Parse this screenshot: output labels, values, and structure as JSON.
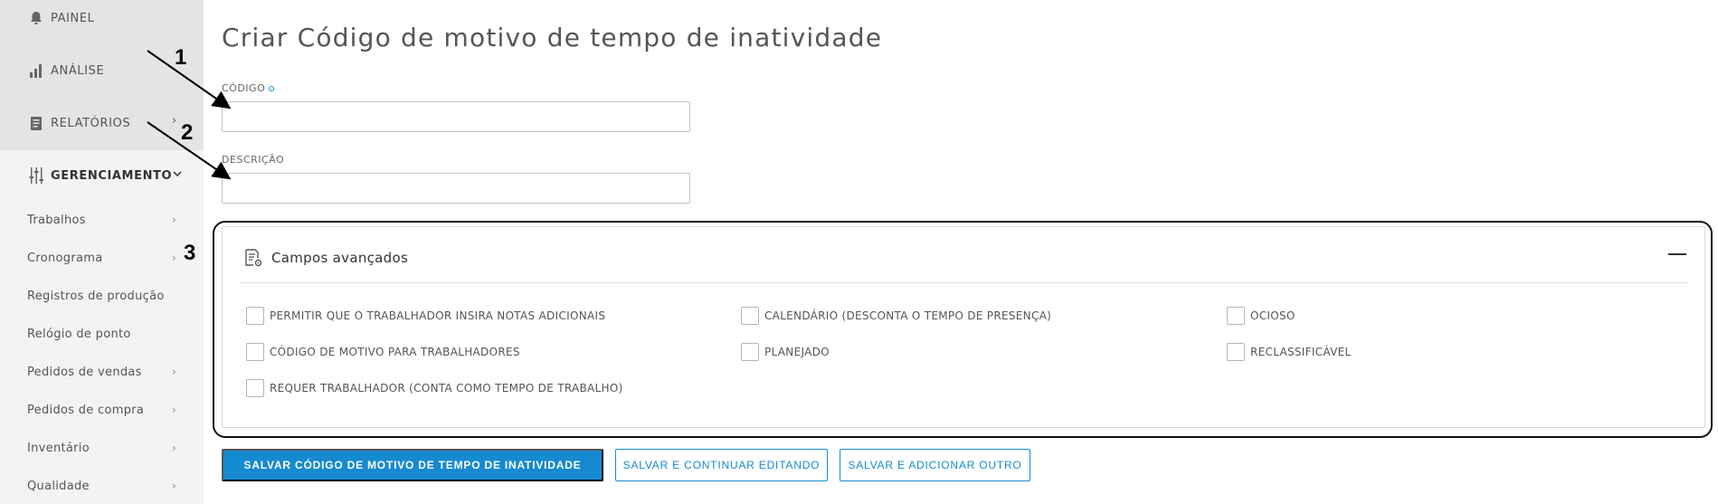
{
  "sidebar": {
    "nav": [
      {
        "label": "PAINEL",
        "icon": "bell-icon"
      },
      {
        "label": "ANÁLISE",
        "icon": "bar-chart-icon"
      },
      {
        "label": "RELATÓRIOS",
        "icon": "report-icon"
      },
      {
        "label": "GERENCIAMENTO",
        "icon": "sliders-icon"
      }
    ],
    "sub_items": [
      {
        "label": "Trabalhos"
      },
      {
        "label": "Cronograma"
      },
      {
        "label": "Registros de produção"
      },
      {
        "label": "Relógio de ponto"
      },
      {
        "label": "Pedidos de vendas"
      },
      {
        "label": "Pedidos de compra"
      },
      {
        "label": "Inventário"
      },
      {
        "label": "Qualidade"
      }
    ]
  },
  "page": {
    "title": "Criar Código de motivo de tempo de inatividade"
  },
  "form": {
    "code_label": "CÓDIGO",
    "code_value": "",
    "description_label": "DESCRIÇÃO",
    "description_value": ""
  },
  "advanced": {
    "title": "Campos avançados",
    "checkboxes": [
      {
        "label": "PERMITIR QUE O TRABALHADOR INSIRA NOTAS ADICIONAIS",
        "checked": false
      },
      {
        "label": "CALENDÁRIO (DESCONTA O TEMPO DE PRESENÇA)",
        "checked": false
      },
      {
        "label": "OCIOSO",
        "checked": false
      },
      {
        "label": "CÓDIGO DE MOTIVO PARA TRABALHADORES",
        "checked": false
      },
      {
        "label": "PLANEJADO",
        "checked": false
      },
      {
        "label": "RECLASSIFICÁVEL",
        "checked": false
      },
      {
        "label": "REQUER TRABALHADOR (CONTA COMO TEMPO DE TRABALHO)",
        "checked": false
      }
    ]
  },
  "buttons": {
    "save": "SALVAR CÓDIGO DE MOTIVO DE TEMPO DE INATIVIDADE",
    "save_continue": "SALVAR E CONTINUAR EDITANDO",
    "save_add": "SALVAR E ADICIONAR OUTRO"
  },
  "annotations": {
    "one": "1",
    "two": "2",
    "three": "3"
  },
  "colors": {
    "accent": "#168ad1",
    "sidebar_bg": "#f3f3f3"
  }
}
